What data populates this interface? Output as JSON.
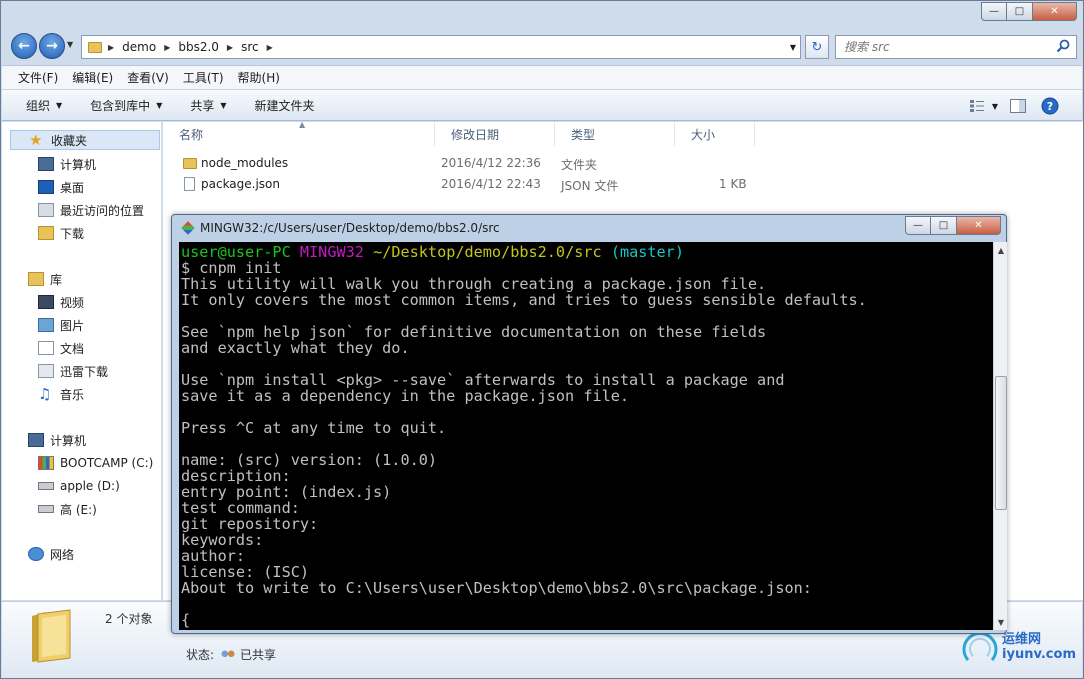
{
  "window": {
    "minimize": "—",
    "maximize": "□",
    "close": "✕"
  },
  "address": {
    "crumbs": [
      "demo",
      "bbs2.0",
      "src"
    ],
    "search_placeholder": "搜索 src"
  },
  "menu": [
    "文件(F)",
    "编辑(E)",
    "查看(V)",
    "工具(T)",
    "帮助(H)"
  ],
  "commands": {
    "organize": "组织",
    "include_library": "包含到库中",
    "share": "共享",
    "new_folder": "新建文件夹"
  },
  "nav": {
    "favorites": "收藏夹",
    "fav_items": [
      "计算机",
      "桌面",
      "最近访问的位置",
      "下载"
    ],
    "libraries": "库",
    "lib_items": [
      "视频",
      "图片",
      "文档",
      "迅雷下载",
      "音乐"
    ],
    "computer": "计算机",
    "drives": [
      "BOOTCAMP (C:)",
      "apple (D:)",
      "高 (E:)"
    ],
    "network": "网络"
  },
  "columns": {
    "name": "名称",
    "modified": "修改日期",
    "type": "类型",
    "size": "大小"
  },
  "files": [
    {
      "name": "node_modules",
      "modified": "2016/4/12 22:36",
      "type": "文件夹",
      "size": ""
    },
    {
      "name": "package.json",
      "modified": "2016/4/12 22:43",
      "type": "JSON 文件",
      "size": "1 KB"
    }
  ],
  "details": {
    "count": "2 个对象",
    "status_label": "状态:",
    "status_value": "已共享"
  },
  "watermark": {
    "cn": "运维网",
    "url": "iyunv.com"
  },
  "terminal": {
    "title": "MINGW32:/c/Users/user/Desktop/demo/bbs2.0/src",
    "prompt_user": "user@user-PC",
    "prompt_env": "MINGW32",
    "prompt_path": "~/Desktop/demo/bbs2.0/src",
    "prompt_branch": "(master)",
    "command": "$ cnpm init",
    "lines": [
      "This utility will walk you through creating a package.json file.",
      "It only covers the most common items, and tries to guess sensible defaults.",
      "",
      "See `npm help json` for definitive documentation on these fields",
      "and exactly what they do.",
      "",
      "Use `npm install <pkg> --save` afterwards to install a package and",
      "save it as a dependency in the package.json file.",
      "",
      "Press ^C at any time to quit.",
      "",
      "name: (src) version: (1.0.0)",
      "description:",
      "entry point: (index.js)",
      "test command:",
      "git repository:",
      "keywords:",
      "author:",
      "license: (ISC)",
      "About to write to C:\\Users\\user\\Desktop\\demo\\bbs2.0\\src\\package.json:",
      "",
      "{"
    ]
  }
}
